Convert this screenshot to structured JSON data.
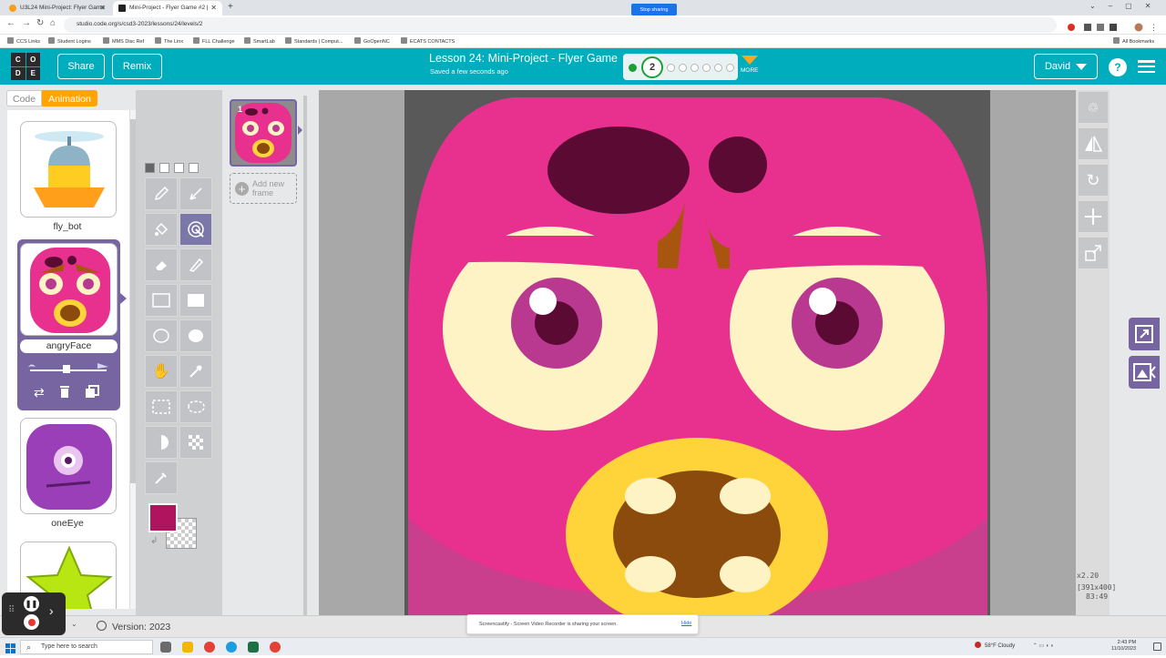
{
  "browser": {
    "tabs": [
      {
        "label": "U3L24 Mini-Project: Flyer Game",
        "active": false
      },
      {
        "label": "Mini-Project - Flyer Game #2 | ",
        "active": true
      }
    ],
    "url": "studio.code.org/s/csd3-2023/lessons/24/levels/2",
    "bookmarks": [
      "CCS Links",
      "Student Logins",
      "MMS Disc Ref",
      "The Linx",
      "FLL Challenge",
      "SmartLab",
      "Standards | Comput...",
      "GoOpenNC",
      "ECATS CONTACTS"
    ],
    "all_bookmarks": "All Bookmarks"
  },
  "header": {
    "logo": [
      "C",
      "O",
      "D",
      "E"
    ],
    "share": "Share",
    "remix": "Remix",
    "lesson_title": "Lesson 24: Mini-Project - Flyer Game",
    "saved": "Saved a few seconds ago",
    "current_level": "2",
    "more": "MORE",
    "user": "David",
    "help": "?"
  },
  "workspace": {
    "toggle": {
      "code": "Code",
      "animation": "Animation"
    },
    "animations": [
      "fly_bot",
      "angryFace",
      "oneEye"
    ],
    "selected_animation": "angryFace",
    "frame_number": "1",
    "add_frame": "Add new frame",
    "zoom": {
      "scale": "x2.20",
      "size": "[391x400]",
      "coords": "83:49"
    },
    "version": "Version: 2023"
  },
  "colors": {
    "accent": "#00adbc",
    "animation_tab": "#ffa400",
    "selected_panel": "#7665a0",
    "primary_color": "#b0145e",
    "face_pink": "#e8308f"
  },
  "screencast": {
    "notice": "Screencastify - Screen Video Recorder is sharing your screen.",
    "stop": "Stop sharing",
    "hide": "Hide"
  },
  "taskbar": {
    "search_placeholder": "Type here to search",
    "weather": "58°F  Cloudy",
    "time": "2:43 PM",
    "date": "11/10/2023"
  }
}
